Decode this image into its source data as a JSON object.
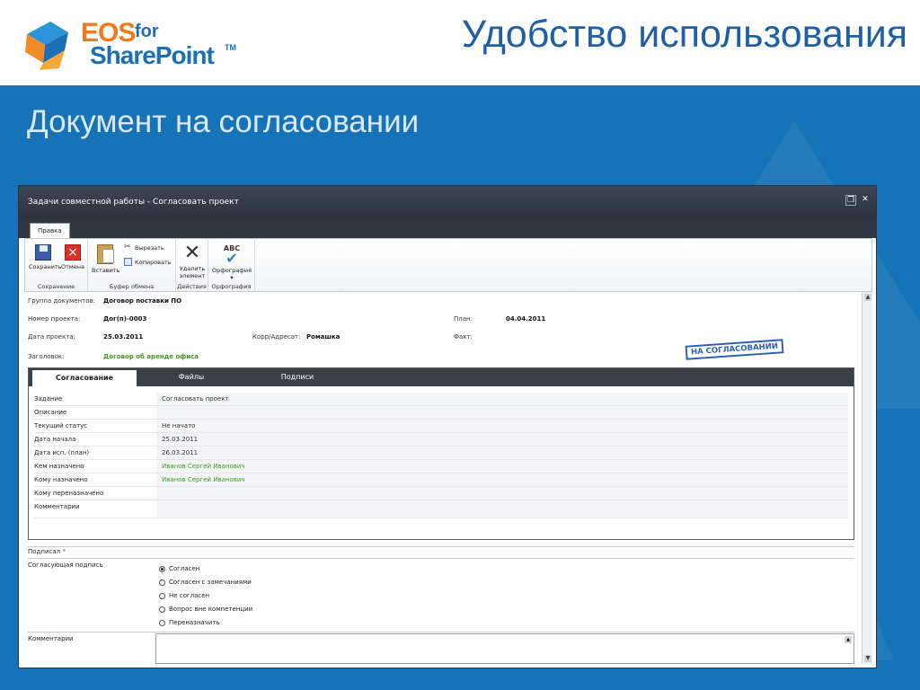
{
  "slide": {
    "logo_eos": "EOS",
    "logo_for": "for",
    "logo_sharepoint": "SharePoint",
    "logo_tm": "TM",
    "title": "Удобство использования",
    "subtitle": "Документ на согласовании"
  },
  "window": {
    "title": "Задачи совместной работы - Согласовать проект",
    "restore_icon": "restore-icon",
    "close_icon": "close-icon"
  },
  "ribbon": {
    "tab_label": "Правка",
    "groups": [
      {
        "label": "Сохранение",
        "buttons": [
          {
            "label": "Сохранить"
          },
          {
            "label": "Отмена"
          }
        ]
      },
      {
        "label": "Буфер обмена",
        "buttons": [
          {
            "label": "Вставить"
          },
          {
            "label": "Вырезать"
          },
          {
            "label": "Копировать"
          }
        ]
      },
      {
        "label": "Действия",
        "buttons": [
          {
            "label": "Удалить элемент"
          }
        ]
      },
      {
        "label": "Орфография",
        "buttons": [
          {
            "label": "Орфография"
          }
        ]
      }
    ],
    "spell_abc": "ABC"
  },
  "document": {
    "doc_group_label": "Группа документов:",
    "doc_group_value": "Договор поставки ПО",
    "project_no_label": "Номер проекта:",
    "project_no_value": "Дог(п)-0003",
    "plan_label": "План:",
    "plan_value": "04.04.2011",
    "project_date_label": "Дата проекта:",
    "project_date_value": "25.03.2011",
    "corr_label": "Корр/Адресат:",
    "corr_value": "Ромашка",
    "fact_label": "Факт:",
    "header_label": "Заголовок:",
    "header_value": "Договор об аренде офиса",
    "stamp": "НА СОГЛАСОВАНИИ"
  },
  "tabs": [
    {
      "label": "Согласование",
      "active": true
    },
    {
      "label": "Файлы",
      "active": false
    },
    {
      "label": "Подписи",
      "active": false
    }
  ],
  "fields": [
    {
      "label": "Задание",
      "value": "Согласовать проект"
    },
    {
      "label": "Описание",
      "value": ""
    },
    {
      "label": "Текущий статус",
      "value": "Не начато"
    },
    {
      "label": "Дата начала",
      "value": "25.03.2011"
    },
    {
      "label": "Дата исп. (план)",
      "value": "26.03.2011"
    },
    {
      "label": "Кем назначено",
      "value": "Иванов Сергей Иванович"
    },
    {
      "label": "Кому назначено",
      "value": "Иванов Сергей Иванович"
    },
    {
      "label": "Кому переназначено",
      "value": ""
    },
    {
      "label": "Комментарии",
      "value": ""
    }
  ],
  "signature": {
    "signed_label": "Подписал",
    "required_mark": "*",
    "agree_label": "Согласующая подпись",
    "options": [
      {
        "label": "Согласен",
        "selected": true
      },
      {
        "label": "Согласен с замечаниями",
        "selected": false
      },
      {
        "label": "Не согласен",
        "selected": false
      },
      {
        "label": "Вопрос вне компетенции",
        "selected": false
      },
      {
        "label": "Переназначить",
        "selected": false
      }
    ],
    "comments_label": "Комментарии"
  },
  "colors": {
    "blue_background": "#1773b8",
    "title_blue": "#1f5fa6",
    "logo_orange": "#f07a1a",
    "assignee_green": "#3f9a1e",
    "stamp_blue": "#2b5fb6"
  }
}
